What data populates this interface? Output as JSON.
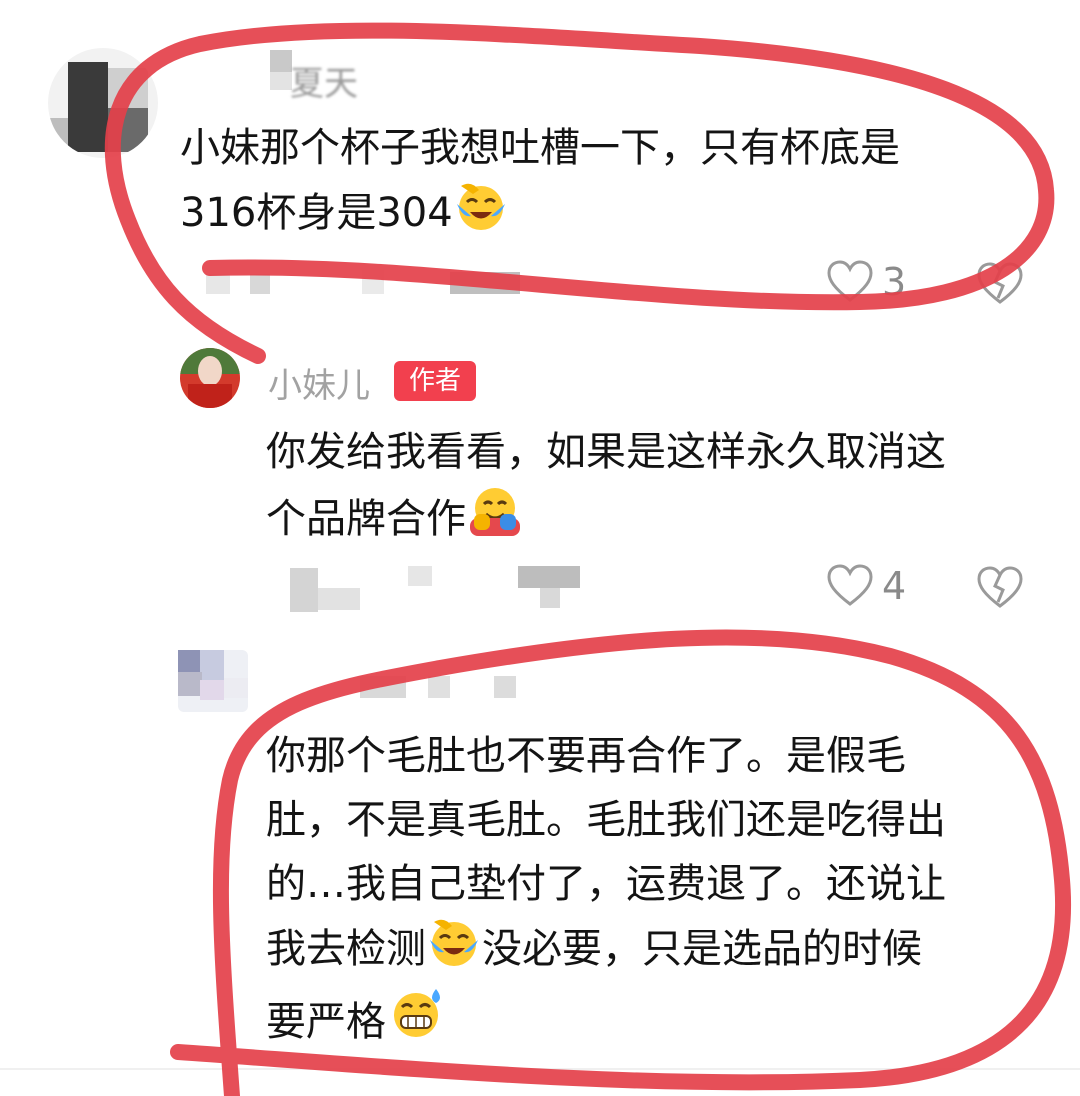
{
  "comments": [
    {
      "name": "夏天",
      "body": [
        "小妹那个杯子我想吐槽一下，只有杯底是",
        "316杯身是304"
      ],
      "emoji": "face-with-tears",
      "likes": "3"
    },
    {
      "name": "小妹儿",
      "badge": "作者",
      "body": [
        "你发给我看看，如果是这样永久取消这",
        "个品牌合作"
      ],
      "emoji": "hugging-face",
      "likes": "4"
    },
    {
      "name": "",
      "body_lines": [
        "你那个毛肚也不要再合作了。是假毛",
        "肚，不是真毛肚。毛肚我们还是吃得出",
        "的…我自己垫付了，运费退了。还说让"
      ],
      "line4_a": "我去检测",
      "line4_b": "没必要，只是选品的时候",
      "line5": "要严格",
      "emojis": [
        "face-with-tears",
        "grinning-sweat-face"
      ]
    }
  ],
  "colors": {
    "annotation": "#e4404a",
    "badge": "#f2404e",
    "meta_gray": "#a2a2a2"
  }
}
